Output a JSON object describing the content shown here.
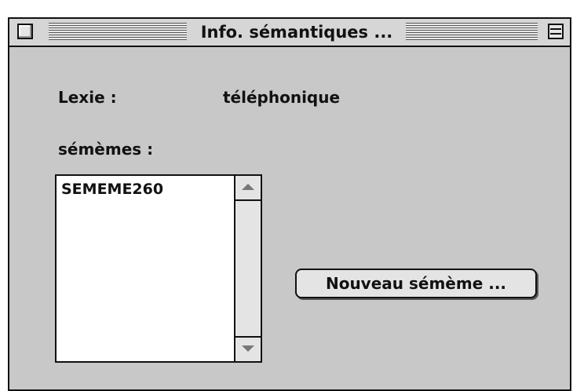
{
  "window": {
    "title": "Info. sémantiques ..."
  },
  "form": {
    "lexie_label": "Lexie :",
    "lexie_value": "téléphonique",
    "sememes_label": "sémèmes :",
    "sememes": [
      {
        "label": "SEMEME260"
      }
    ],
    "new_sememe_button": "Nouveau sémème ..."
  },
  "icons": {
    "close": "close-box-icon",
    "zoom": "zoom-box-icon",
    "scroll_up": "scroll-up-arrow-icon",
    "scroll_down": "scroll-down-arrow-icon"
  },
  "colors": {
    "window_background": "#c8c8c8",
    "titlebar_background": "#d6d6d6",
    "border": "#111111"
  }
}
